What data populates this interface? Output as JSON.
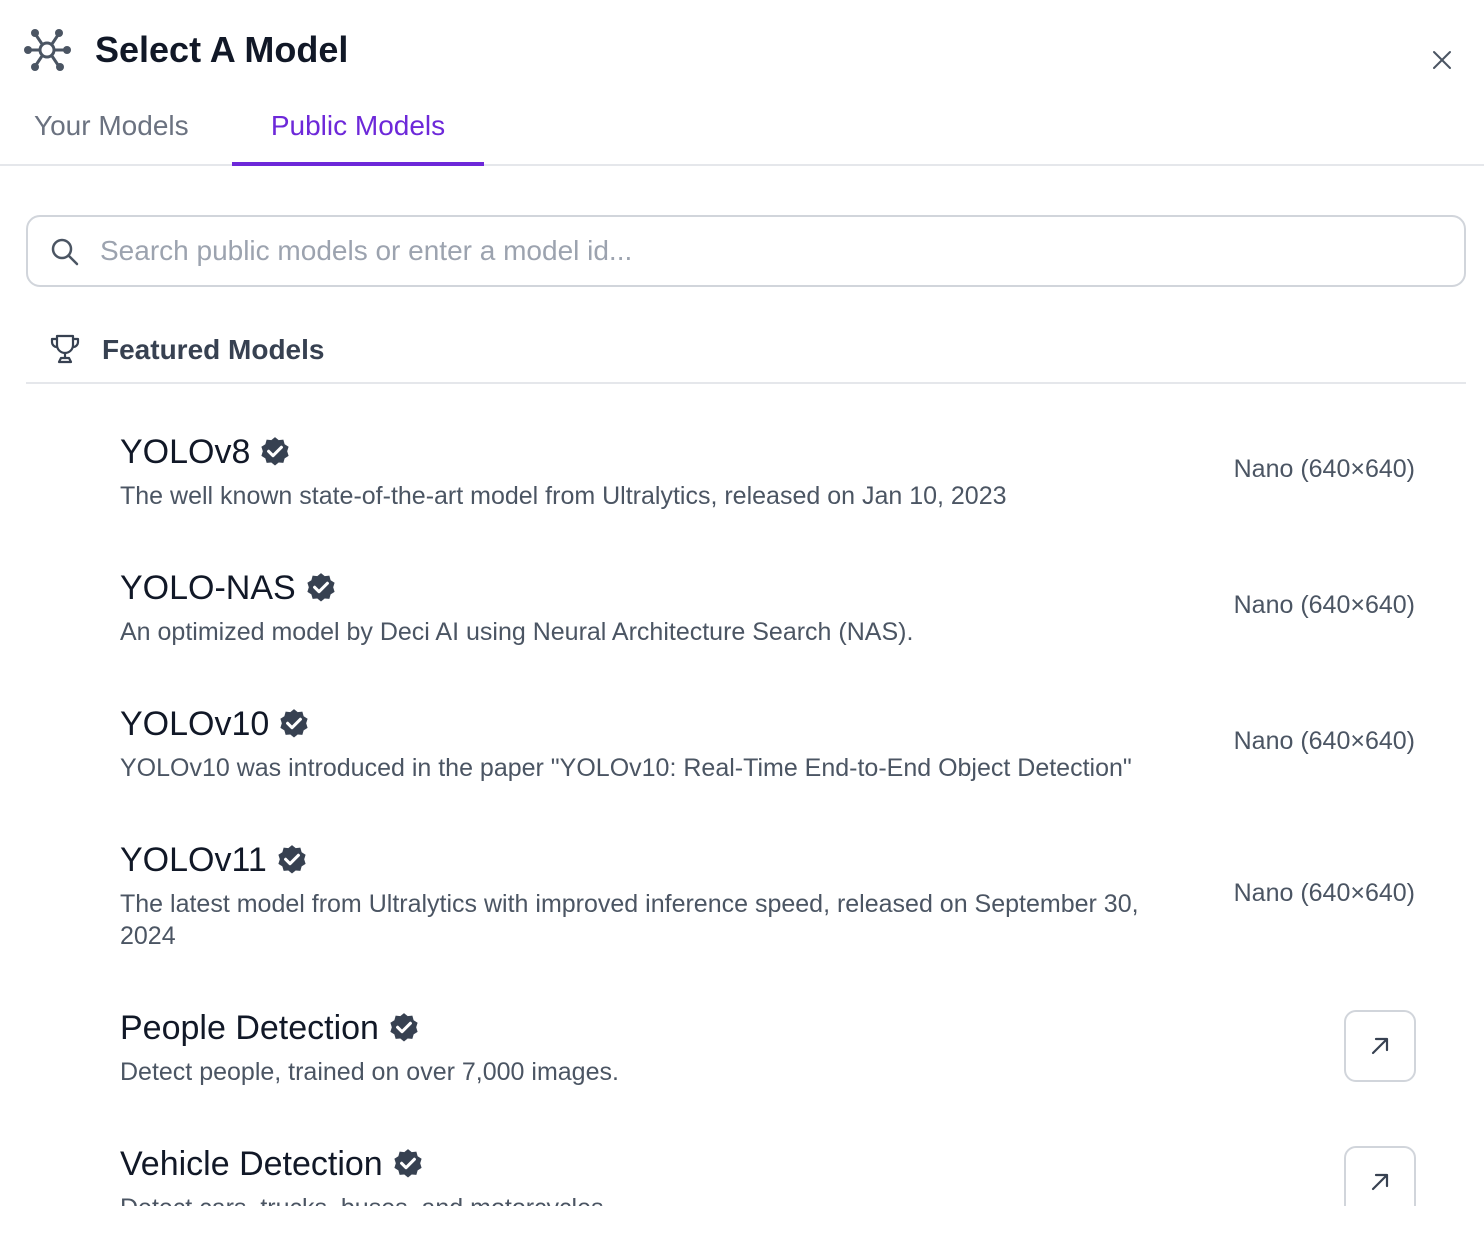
{
  "header": {
    "title": "Select A Model",
    "logo_icon": "model-graph-icon",
    "close_icon": "close-icon"
  },
  "tabs": [
    {
      "label": "Your Models",
      "active": false
    },
    {
      "label": "Public Models",
      "active": true
    }
  ],
  "search": {
    "placeholder": "Search public models or enter a model id...",
    "value": "",
    "icon": "search-icon"
  },
  "featured": {
    "title": "Featured Models",
    "icon": "trophy-icon"
  },
  "models": [
    {
      "name": "YOLOv8",
      "description": "The well known state-of-the-art model from Ultralytics, released on Jan 10, 2023",
      "size": "Nano (640×640)"
    },
    {
      "name": "YOLO-NAS",
      "description": "An optimized model by Deci AI using Neural Architecture Search (NAS).",
      "size": "Nano (640×640)"
    },
    {
      "name": "YOLOv10",
      "description": "YOLOv10 was introduced in the paper \"YOLOv10: Real-Time End-to-End Object Detection\"",
      "size": "Nano (640×640)"
    },
    {
      "name": "YOLOv11",
      "description": "The latest model from Ultralytics with improved inference speed, released on September 30, 2024",
      "size": "Nano (640×640)"
    },
    {
      "name": "People Detection",
      "description": "Detect people, trained on over 7,000 images.",
      "action_icon": "arrow-up-right-icon"
    },
    {
      "name": "Vehicle Detection",
      "description": "Detect cars, trucks, buses, and motorcycles.",
      "action_icon": "arrow-up-right-icon"
    }
  ],
  "colors": {
    "accent": "#6d28d9",
    "verified_badge": "#374151",
    "border": "#d1d5db",
    "muted_text": "#4b5563"
  }
}
